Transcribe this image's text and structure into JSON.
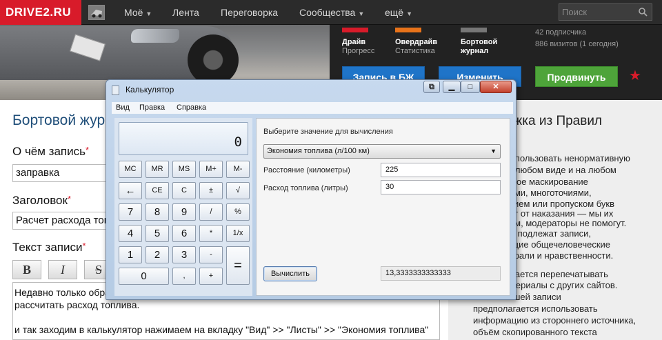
{
  "site": {
    "logo": "DRIVE2.RU",
    "nav": [
      {
        "label": "Моё",
        "caret": true
      },
      {
        "label": "Лента",
        "caret": false
      },
      {
        "label": "Переговорка",
        "caret": false
      },
      {
        "label": "Сообщества",
        "caret": true
      },
      {
        "label": "ещё",
        "caret": true
      }
    ],
    "search_placeholder": "Поиск"
  },
  "profile": {
    "stats": [
      {
        "title": "Драйв",
        "sub": "Прогресс",
        "color": "#d81b2a"
      },
      {
        "title": "Овердрайв",
        "sub": "Статистика",
        "color": "#e8731a"
      },
      {
        "title": "Бортовой",
        "sub": "журнал",
        "color": "#777777"
      }
    ],
    "subscribers": "42 подписчика",
    "visits": "886 визитов (1 сегодня)",
    "btn_log": "Запись в БЖ",
    "btn_edit": "Изменить",
    "btn_promote": "Продвинуть"
  },
  "form": {
    "page_title": "Бортовой журнал",
    "about_label": "О чём запись",
    "about_value": "заправка",
    "heading_label": "Заголовок",
    "heading_value": "Расчет расхода топлива",
    "text_label": "Текст записи",
    "toolbar": [
      "B",
      "I",
      "S"
    ],
    "editor_lines": [
      "Недавно только обратил внимание, что в стандартном калькуляторе windows 7 можно",
      "рассчитать расход топлива.",
      "",
      "и так заходим  в калькулятор нажимаем на вкладку \"Вид\" >> \"Листы\" >> \"Экономия топлива\""
    ]
  },
  "rules": {
    "title": "Выдержка из Правил",
    "lines": [
      "Нельзя использовать ненормативную",
      "лексику в любом виде и на любом",
      "языке. Такое маскирование",
      "звездочками, многоточиями,",
      "сокращением или пропуском букв",
      "не спасает от наказания — мы их",
      "не заметим, модераторы не помогут.",
      "",
      "Удалению подлежат записи,",
      "нарушающие общечеловеческие",
      "нормы морали и нравственности.",
      "",
      "Не допускается перепечатывать",
      "чужие материалы с других сайтов.",
      "Если в вашей записи",
      "предполагается использовать",
      "информацию из стороннего источника,",
      "объём скопированного текста"
    ]
  },
  "calculator": {
    "title": "Калькулятор",
    "menu": [
      "Вид",
      "Правка",
      "Справка"
    ],
    "display": "0",
    "keys": [
      "MC",
      "MR",
      "MS",
      "M+",
      "M-",
      "←",
      "CE",
      "C",
      "±",
      "√",
      "7",
      "8",
      "9",
      "/",
      "%",
      "4",
      "5",
      "6",
      "*",
      "1/x",
      "1",
      "2",
      "3",
      "-",
      "=",
      "0",
      ",",
      "+"
    ],
    "select_prompt": "Выберите значение для вычисления",
    "select_value": "Экономия топлива (л/100 км)",
    "distance_label": "Расстояние (километры)",
    "distance_value": "225",
    "fuel_label": "Расход топлива (литры)",
    "fuel_value": "30",
    "compute_button": "Вычислить",
    "result": "13,3333333333333"
  }
}
